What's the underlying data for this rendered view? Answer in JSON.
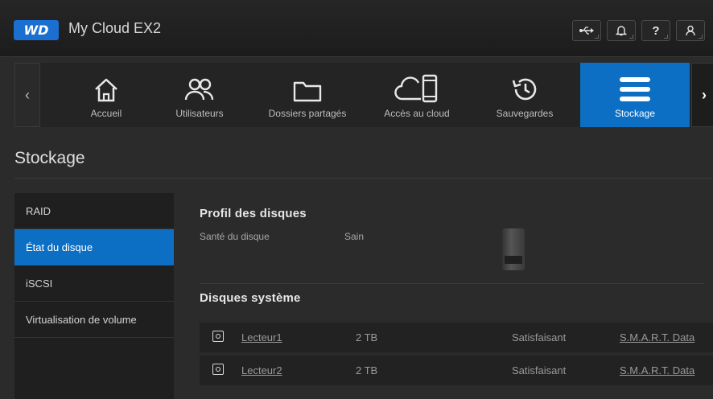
{
  "header": {
    "logo_text": "WD",
    "app_title": "My Cloud EX2",
    "icons": [
      "usb-icon",
      "bell-icon",
      "help-icon",
      "user-icon"
    ],
    "help_glyph": "?"
  },
  "nav": {
    "items": [
      {
        "label": "Accueil",
        "icon": "home-icon"
      },
      {
        "label": "Utilisateurs",
        "icon": "users-icon"
      },
      {
        "label": "Dossiers partagés",
        "icon": "folder-icon"
      },
      {
        "label": "Accès au cloud",
        "icon": "cloud-device-icon"
      },
      {
        "label": "Sauvegardes",
        "icon": "history-icon"
      },
      {
        "label": "Stockage",
        "icon": "storage-icon",
        "active": true
      }
    ],
    "accent_color": "#0d6fc4"
  },
  "page": {
    "title": "Stockage"
  },
  "sidebar": {
    "items": [
      {
        "label": "RAID"
      },
      {
        "label": "État du disque",
        "active": true
      },
      {
        "label": "iSCSI"
      },
      {
        "label": "Virtualisation de volume"
      }
    ]
  },
  "profile": {
    "title": "Profil des disques",
    "health_label": "Santé du disque",
    "health_value": "Sain"
  },
  "system_disks": {
    "title": "Disques système",
    "rows": [
      {
        "name": "Lecteur1",
        "size": "2 TB",
        "status": "Satisfaisant",
        "smart": "S.M.A.R.T. Data"
      },
      {
        "name": "Lecteur2",
        "size": "2 TB",
        "status": "Satisfaisant",
        "smart": "S.M.A.R.T. Data"
      }
    ]
  }
}
